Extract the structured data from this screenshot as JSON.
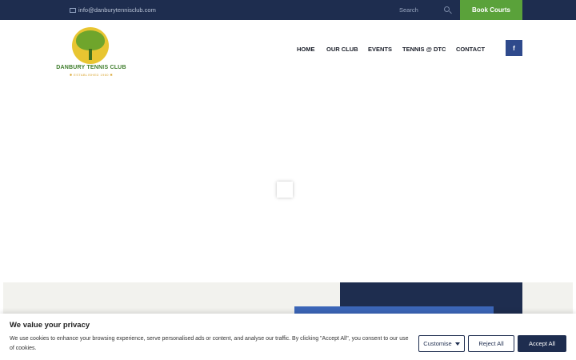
{
  "topbar": {
    "email": "info@danburytennisclub.com",
    "search_placeholder": "Search",
    "book_label": "Book Courts"
  },
  "logo": {
    "name": "DANBURY TENNIS CLUB",
    "established": "✱ ESTABLISHED 1960 ✱"
  },
  "nav": {
    "items": [
      "HOME",
      "OUR CLUB",
      "EVENTS",
      "TENNIS @ DTC",
      "CONTACT"
    ],
    "facebook_glyph": "f"
  },
  "cookie": {
    "title": "We value your privacy",
    "text": "We use cookies to enhance your browsing experience, serve personalised ads or content, and analyse our traffic. By clicking \"Accept All\", you consent to our use of cookies.",
    "customise_label": "Customise",
    "reject_label": "Reject All",
    "accept_label": "Accept All"
  },
  "colors": {
    "navy": "#1e2d4f",
    "green": "#5aa23a",
    "blue": "#3c66b8",
    "facebook": "#2f4a8c"
  },
  "icons": [
    "mail-icon",
    "search-icon",
    "facebook-icon",
    "caret-down-icon",
    "tree-logo"
  ]
}
